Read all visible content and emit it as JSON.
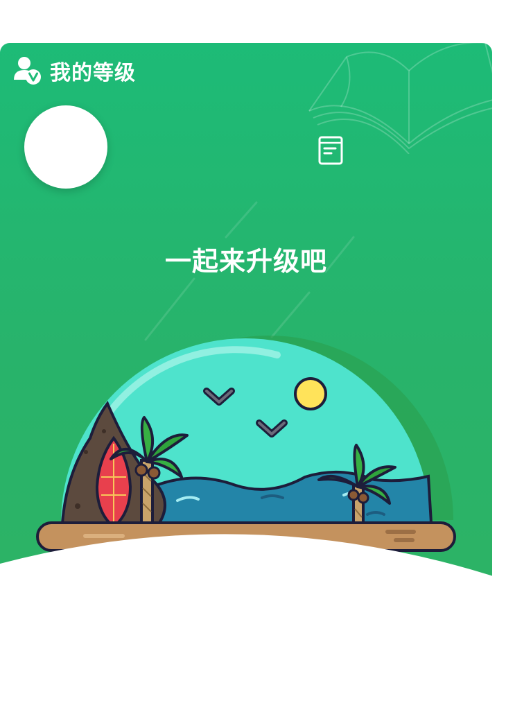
{
  "header": {
    "title": "我的等级",
    "icon": "user-v-icon"
  },
  "avatar": {
    "icon": "avatar"
  },
  "doc_button": {
    "icon": "document-icon"
  },
  "slogan": "一起来升级吧",
  "colors": {
    "primary": "#1dbb77",
    "secondary": "#2fb362"
  }
}
